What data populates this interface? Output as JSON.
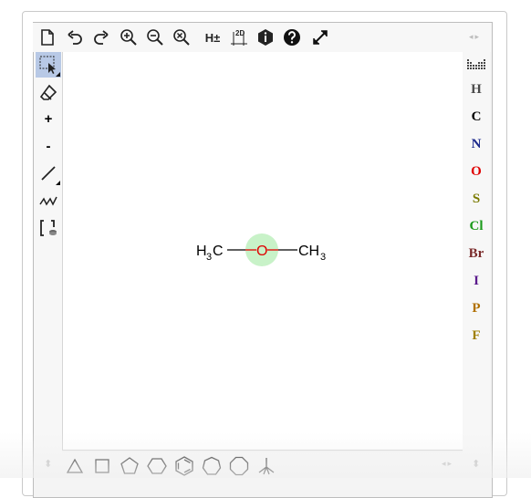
{
  "toolbar": {
    "items": [
      {
        "name": "new-document-icon"
      },
      {
        "name": "undo-icon"
      },
      {
        "name": "redo-icon"
      },
      {
        "name": "zoom-in-icon"
      },
      {
        "name": "zoom-out-icon"
      },
      {
        "name": "zoom-reset-icon"
      },
      {
        "name": "hydrogen-toggle",
        "label": "H±"
      },
      {
        "name": "clean-2d-icon",
        "label": "2D"
      },
      {
        "name": "info-icon"
      },
      {
        "name": "help-icon"
      },
      {
        "name": "fullscreen-icon"
      }
    ],
    "scroll_arrows": "◂▸"
  },
  "left_tools": [
    {
      "name": "selection-tool",
      "icon": "select-lasso-icon",
      "active": true
    },
    {
      "name": "eraser-tool",
      "icon": "eraser-icon"
    },
    {
      "name": "charge-plus-tool",
      "label": "+"
    },
    {
      "name": "charge-minus-tool",
      "label": "-"
    },
    {
      "name": "bond-tool",
      "icon": "single-bond-icon"
    },
    {
      "name": "chain-tool",
      "icon": "chain-icon"
    },
    {
      "name": "bracket-tool",
      "icon": "bracket-icon"
    }
  ],
  "atoms": [
    {
      "symbol": "H",
      "color": "#4a4a4a"
    },
    {
      "symbol": "C",
      "color": "#000000"
    },
    {
      "symbol": "N",
      "color": "#1c2a8c"
    },
    {
      "symbol": "O",
      "color": "#e00000"
    },
    {
      "symbol": "S",
      "color": "#7a7a00"
    },
    {
      "symbol": "Cl",
      "color": "#1a9a1a"
    },
    {
      "symbol": "Br",
      "color": "#7a2a2a"
    },
    {
      "symbol": "I",
      "color": "#5a1a8c"
    },
    {
      "symbol": "P",
      "color": "#b07000"
    },
    {
      "symbol": "F",
      "color": "#a08000"
    }
  ],
  "periodic_table_icon": "periodic-table-icon",
  "molecule": {
    "left_group": "H",
    "left_sub": "3",
    "left_c": "C",
    "center_atom": "O",
    "right_c": "CH",
    "right_sub": "3",
    "highlight_color": "#c8f2c8",
    "oxygen_color": "#e00000"
  },
  "shapes": [
    {
      "name": "cyclopropane-template",
      "icon": "triangle-icon"
    },
    {
      "name": "cyclobutane-template",
      "icon": "square-icon"
    },
    {
      "name": "cyclopentane-template",
      "icon": "pentagon-icon"
    },
    {
      "name": "cyclohexane-template",
      "icon": "hexagon-icon"
    },
    {
      "name": "benzene-template",
      "icon": "benzene-icon"
    },
    {
      "name": "cycloheptane-template",
      "icon": "heptagon-icon"
    },
    {
      "name": "cyclooctane-template",
      "icon": "octagon-icon"
    },
    {
      "name": "cyclopentadiene-template",
      "icon": "tripod-icon"
    }
  ],
  "bottom_scroll": "◂▸",
  "vertical_scroll": "⬍"
}
